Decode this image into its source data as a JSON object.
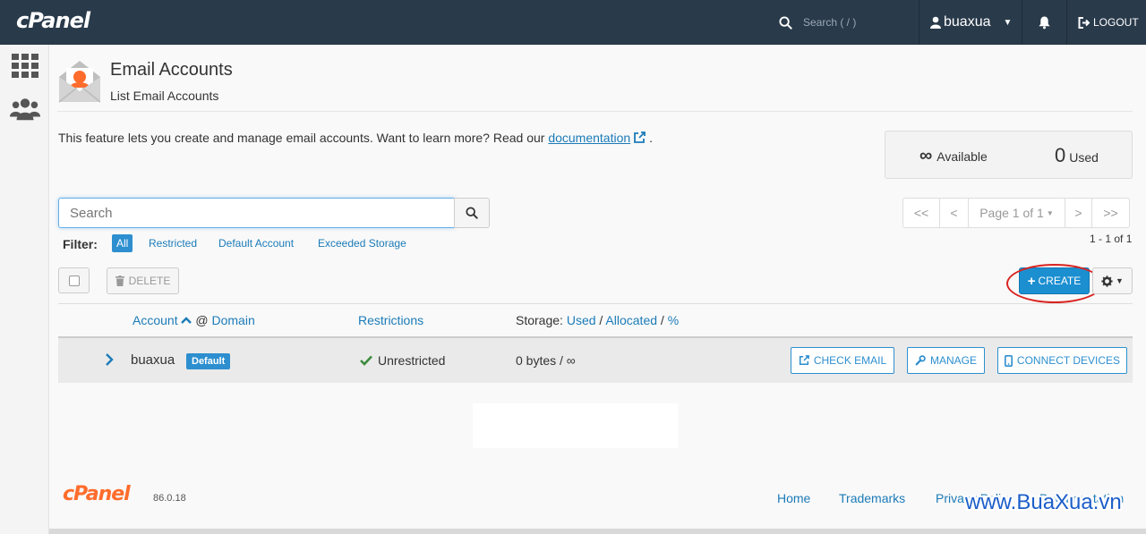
{
  "topbar": {
    "logo": "cPanel",
    "search_placeholder": "Search ( / )",
    "username": "buaxua",
    "logout": "LOGOUT"
  },
  "header": {
    "title": "Email Accounts",
    "subtitle": "List Email Accounts"
  },
  "intro": {
    "text": "This feature lets you create and manage email accounts. Want to learn more? Read our ",
    "link": "documentation",
    "end": "."
  },
  "stats": {
    "available_value": "∞",
    "available_label": "Available",
    "used_value": "0",
    "used_label": "Used"
  },
  "search": {
    "placeholder": "Search"
  },
  "pager": {
    "first": "<<",
    "prev": "<",
    "page": "Page 1 of 1",
    "next": ">",
    "last": ">>",
    "range": "1 - 1 of 1"
  },
  "filter": {
    "label": "Filter:",
    "options": [
      "All",
      "Restricted",
      "Default Account",
      "Exceeded Storage"
    ],
    "active": "All"
  },
  "toolbar": {
    "delete": "DELETE",
    "create": "CREATE"
  },
  "table": {
    "col_account": "Account",
    "col_at": "@",
    "col_domain": "Domain",
    "col_restrictions": "Restrictions",
    "col_storage_prefix": "Storage:",
    "col_used": "Used",
    "col_allocated": "Allocated",
    "col_percent": "%",
    "sep": "/",
    "rows": [
      {
        "account": "buaxua",
        "badge": "Default",
        "restriction": "Unrestricted",
        "storage": "0 bytes / ∞",
        "actions": [
          "CHECK EMAIL",
          "MANAGE",
          "CONNECT DEVICES"
        ]
      }
    ]
  },
  "footer": {
    "logo": "cPanel",
    "version": "86.0.18",
    "links": [
      "Home",
      "Trademarks",
      "Privacy Policy",
      "Documentation"
    ]
  },
  "watermark": "www.BuaXua.vn",
  "colors": {
    "topbar": "#293a4a",
    "accent": "#1b8fd0",
    "highlight": "#d9231f",
    "footer_logo": "#ff6c2c"
  }
}
